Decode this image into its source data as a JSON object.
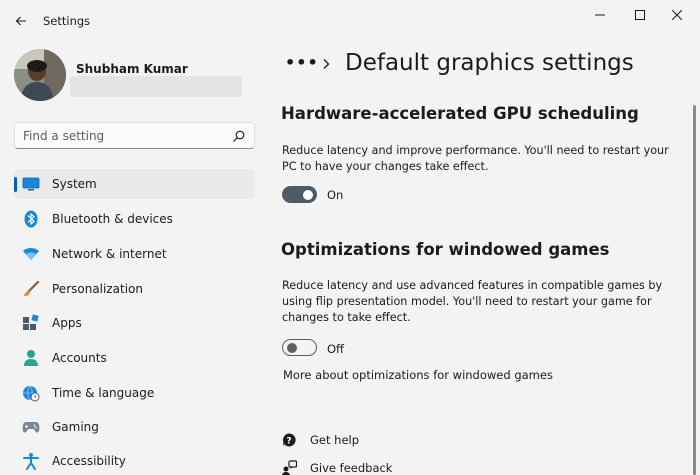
{
  "window": {
    "app_title": "Settings"
  },
  "profile": {
    "name": "Shubham Kumar"
  },
  "search": {
    "placeholder": "Find a setting"
  },
  "sidebar": {
    "items": [
      {
        "label": "System",
        "icon": "system-icon",
        "active": true
      },
      {
        "label": "Bluetooth & devices",
        "icon": "bluetooth-icon"
      },
      {
        "label": "Network & internet",
        "icon": "wifi-icon"
      },
      {
        "label": "Personalization",
        "icon": "brush-icon"
      },
      {
        "label": "Apps",
        "icon": "apps-icon"
      },
      {
        "label": "Accounts",
        "icon": "person-icon"
      },
      {
        "label": "Time & language",
        "icon": "globe-clock-icon"
      },
      {
        "label": "Gaming",
        "icon": "gamepad-icon"
      },
      {
        "label": "Accessibility",
        "icon": "accessibility-icon"
      }
    ]
  },
  "header": {
    "breadcrumb_more": "•••",
    "title": "Default graphics settings"
  },
  "sections": {
    "gpu": {
      "title": "Hardware-accelerated GPU scheduling",
      "description": "Reduce latency and improve performance. You'll need to restart your PC to have your changes take effect.",
      "toggle_state": "On",
      "enabled": true
    },
    "windowed": {
      "title": "Optimizations for windowed games",
      "description": "Reduce latency and use advanced features in compatible games by using flip presentation model. You'll need to restart your game for changes to take effect.",
      "toggle_state": "Off",
      "enabled": false,
      "link": "More about optimizations for windowed games"
    }
  },
  "help": {
    "get_help": "Get help",
    "give_feedback": "Give feedback"
  },
  "colors": {
    "accent": "#005fb8",
    "toggle_on": "#4e5b66",
    "window_bg": "#f3f3f3"
  }
}
